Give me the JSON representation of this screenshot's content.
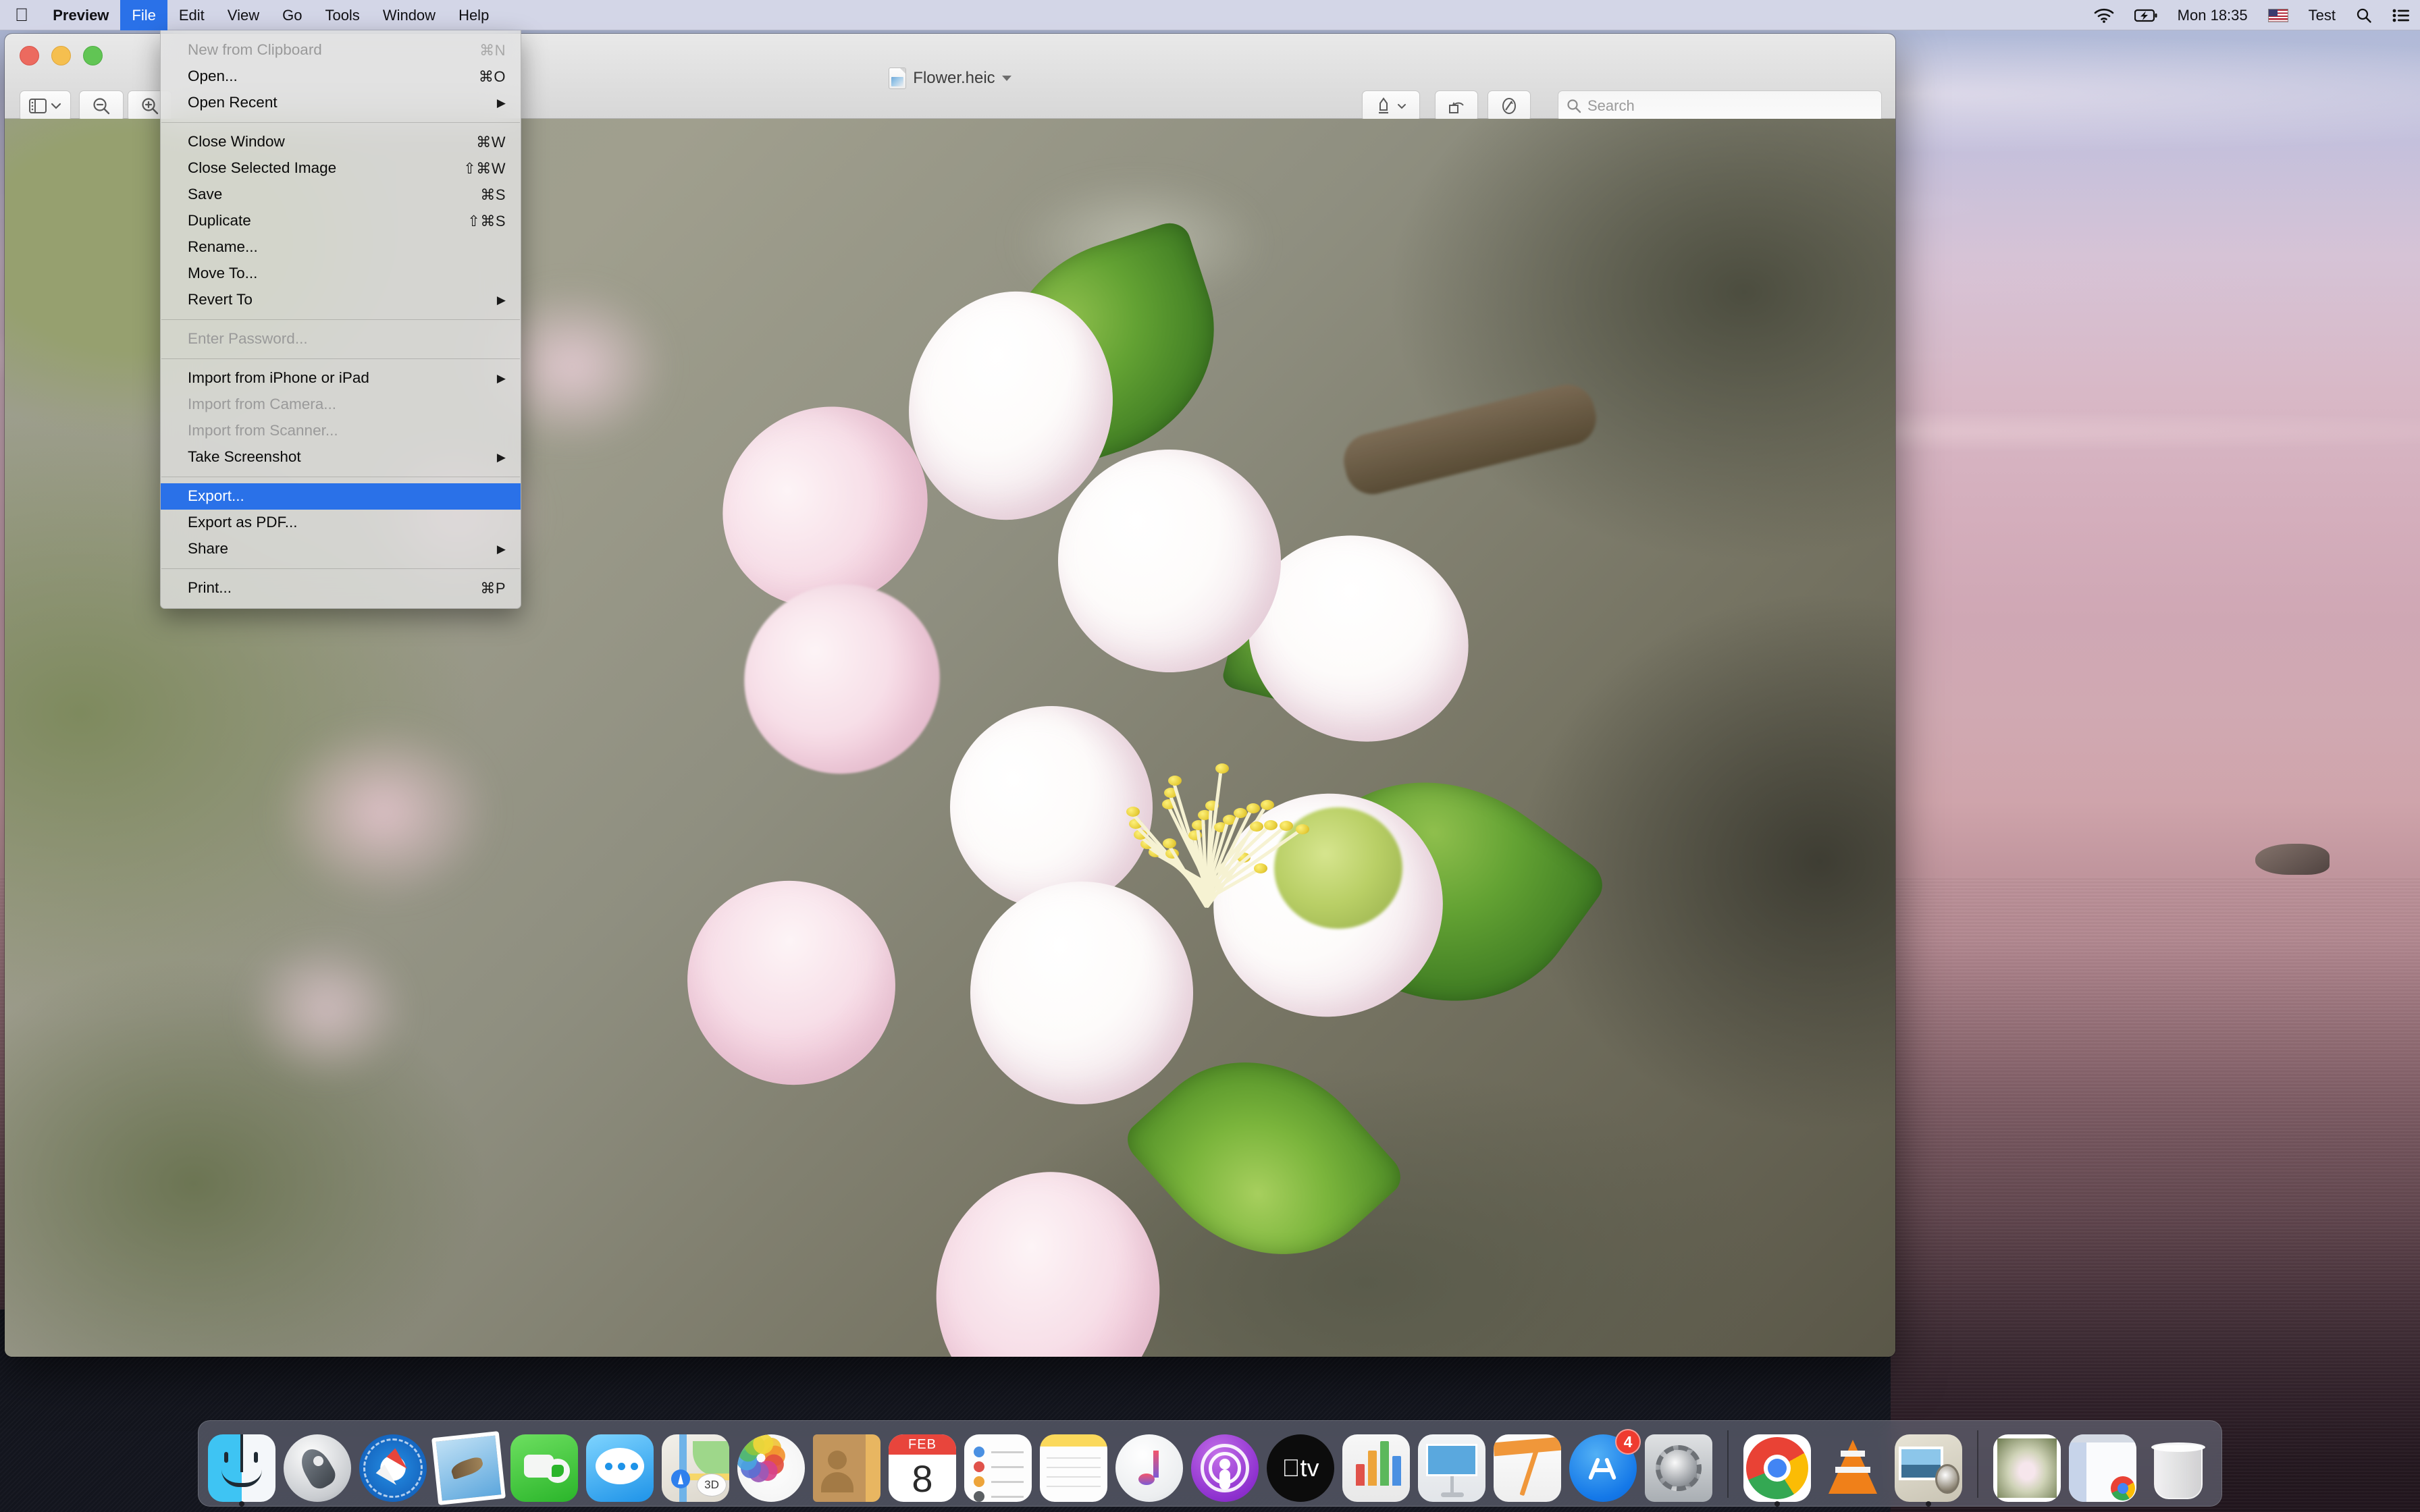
{
  "menubar": {
    "apple_icon": "apple-logo",
    "app_name": "Preview",
    "items": [
      "File",
      "Edit",
      "View",
      "Go",
      "Tools",
      "Window",
      "Help"
    ],
    "active_item": "File",
    "status": {
      "wifi_icon": "wifi-icon",
      "battery_icon": "battery-charging-icon",
      "clock": "Mon 18:35",
      "flag_icon": "us-flag-icon",
      "user": "Test",
      "search_icon": "spotlight-search-icon",
      "control_center_icon": "control-center-icon"
    }
  },
  "file_menu": {
    "sections": [
      {
        "items": [
          {
            "label": "New from Clipboard",
            "shortcut": "⌘N",
            "disabled": true,
            "submenu": false,
            "highlight": false
          },
          {
            "label": "Open...",
            "shortcut": "⌘O",
            "disabled": false,
            "submenu": false,
            "highlight": false
          },
          {
            "label": "Open Recent",
            "shortcut": "",
            "disabled": false,
            "submenu": true,
            "highlight": false
          }
        ]
      },
      {
        "items": [
          {
            "label": "Close Window",
            "shortcut": "⌘W",
            "disabled": false,
            "submenu": false,
            "highlight": false
          },
          {
            "label": "Close Selected Image",
            "shortcut": "⇧⌘W",
            "disabled": false,
            "submenu": false,
            "highlight": false
          },
          {
            "label": "Save",
            "shortcut": "⌘S",
            "disabled": false,
            "submenu": false,
            "highlight": false
          },
          {
            "label": "Duplicate",
            "shortcut": "⇧⌘S",
            "disabled": false,
            "submenu": false,
            "highlight": false
          },
          {
            "label": "Rename...",
            "shortcut": "",
            "disabled": false,
            "submenu": false,
            "highlight": false
          },
          {
            "label": "Move To...",
            "shortcut": "",
            "disabled": false,
            "submenu": false,
            "highlight": false
          },
          {
            "label": "Revert To",
            "shortcut": "",
            "disabled": false,
            "submenu": true,
            "highlight": false
          }
        ]
      },
      {
        "items": [
          {
            "label": "Enter Password...",
            "shortcut": "",
            "disabled": true,
            "submenu": false,
            "highlight": false
          }
        ]
      },
      {
        "items": [
          {
            "label": "Import from iPhone or iPad",
            "shortcut": "",
            "disabled": false,
            "submenu": true,
            "highlight": false
          },
          {
            "label": "Import from Camera...",
            "shortcut": "",
            "disabled": true,
            "submenu": false,
            "highlight": false
          },
          {
            "label": "Import from Scanner...",
            "shortcut": "",
            "disabled": true,
            "submenu": false,
            "highlight": false
          },
          {
            "label": "Take Screenshot",
            "shortcut": "",
            "disabled": false,
            "submenu": true,
            "highlight": false
          }
        ]
      },
      {
        "items": [
          {
            "label": "Export...",
            "shortcut": "",
            "disabled": false,
            "submenu": false,
            "highlight": true
          },
          {
            "label": "Export as PDF...",
            "shortcut": "",
            "disabled": false,
            "submenu": false,
            "highlight": false
          },
          {
            "label": "Share",
            "shortcut": "",
            "disabled": false,
            "submenu": true,
            "highlight": false
          }
        ]
      },
      {
        "items": [
          {
            "label": "Print...",
            "shortcut": "⌘P",
            "disabled": false,
            "submenu": false,
            "highlight": false
          }
        ]
      }
    ],
    "highlight_color": "#2a71e8"
  },
  "preview_window": {
    "document_title": "Flower.heic",
    "traffic_lights": {
      "close": "close-button",
      "minimize": "minimize-button",
      "zoom": "zoom-button"
    },
    "toolbar": {
      "sidebar_label": "sidebar-view-button",
      "zoom_out_label": "zoom-out-button",
      "zoom_in_label": "zoom-in-button",
      "markup_label": "markup-toolbar-button",
      "rotate_label": "rotate-left-button",
      "share_label": "share-button",
      "search_placeholder": "Search"
    },
    "image_alt": "apple blossom flower photograph"
  },
  "dock": {
    "items": [
      {
        "name": "Finder",
        "running": true
      },
      {
        "name": "Launchpad",
        "running": false
      },
      {
        "name": "Safari",
        "running": false
      },
      {
        "name": "Mail",
        "running": false
      },
      {
        "name": "FaceTime",
        "running": false
      },
      {
        "name": "Messages",
        "running": false
      },
      {
        "name": "Maps",
        "running": false
      },
      {
        "name": "Photos",
        "running": false
      },
      {
        "name": "Contacts",
        "running": false
      },
      {
        "name": "Calendar",
        "running": false,
        "month": "FEB",
        "day": "8"
      },
      {
        "name": "Reminders",
        "running": false
      },
      {
        "name": "Notes",
        "running": false
      },
      {
        "name": "Music",
        "running": false
      },
      {
        "name": "Podcasts",
        "running": false
      },
      {
        "name": "TV",
        "running": false,
        "glyph": "tv"
      },
      {
        "name": "Numbers",
        "running": false
      },
      {
        "name": "Keynote",
        "running": false
      },
      {
        "name": "Pages",
        "running": false
      },
      {
        "name": "App Store",
        "running": false,
        "badge": "4"
      },
      {
        "name": "System Preferences",
        "running": false
      }
    ],
    "running_items": [
      {
        "name": "Google Chrome",
        "running": true
      },
      {
        "name": "VLC",
        "running": false
      },
      {
        "name": "Preview",
        "running": true
      }
    ],
    "minimized_items": [
      {
        "name": "Flower.heic minimized window"
      },
      {
        "name": "Chrome minimized window"
      }
    ],
    "trash": {
      "name": "Trash"
    }
  }
}
